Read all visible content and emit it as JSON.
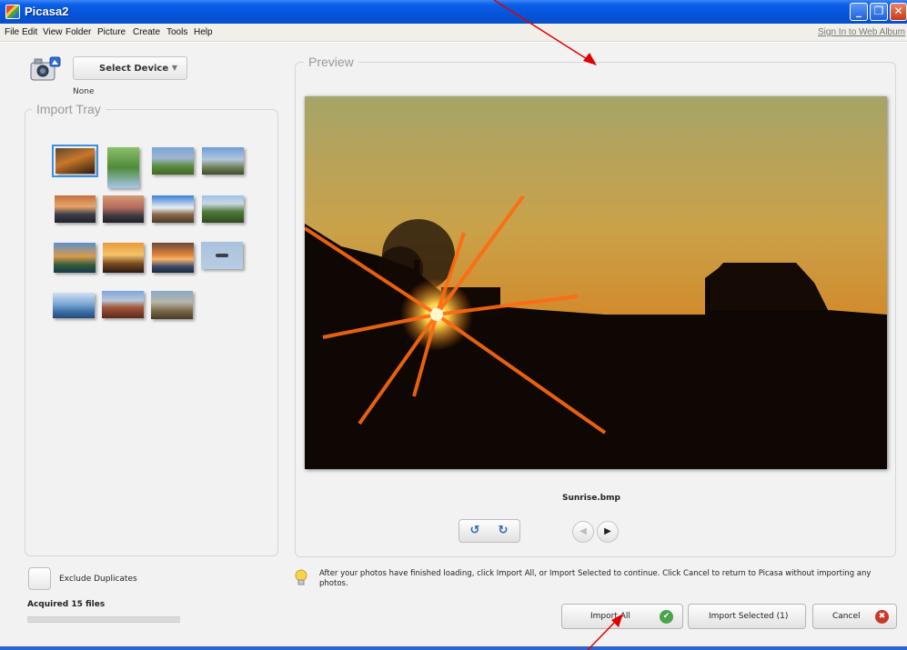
{
  "window": {
    "title": "Picasa2",
    "minimize_label": "_",
    "maximize_label": "❐",
    "close_label": "✕"
  },
  "menu": {
    "items": [
      "File",
      "Edit",
      "View",
      "Folder",
      "Picture",
      "Create",
      "Tools",
      "Help"
    ],
    "sign_in": "Sign In to Web Album"
  },
  "device": {
    "icon": "camera-icon",
    "select_label": "Select Device",
    "dropdown_arrow": "▼",
    "selected_value": "None"
  },
  "import_tray": {
    "title": "Import Tray",
    "thumbnail_count": 15,
    "selected_index": 0
  },
  "preview": {
    "title": "Preview",
    "filename": "Sunrise.bmp",
    "rotate_left_icon": "↺",
    "rotate_right_icon": "↻",
    "prev_icon": "◀",
    "next_icon": "▶"
  },
  "options": {
    "exclude_duplicates_label": "Exclude Duplicates",
    "acquired_text": "Acquired 15 files"
  },
  "hint": {
    "icon": "lightbulb-icon",
    "text": "After your photos have finished loading, click Import All, or Import Selected to continue. Click Cancel to return to Picasa without importing any photos."
  },
  "actions": {
    "import_all_label": "Import All",
    "import_all_icon": "✔",
    "import_selected_label": "Import Selected (1)",
    "cancel_label": "Cancel",
    "cancel_icon": "✖"
  },
  "colors": {
    "titlebar": "#0553d6",
    "accent": "#2d66c8",
    "selection": "#3d8fe0",
    "annotation_arrow": "#e00000",
    "ok_green": "#4aa34a",
    "cancel_red": "#c8372a"
  }
}
